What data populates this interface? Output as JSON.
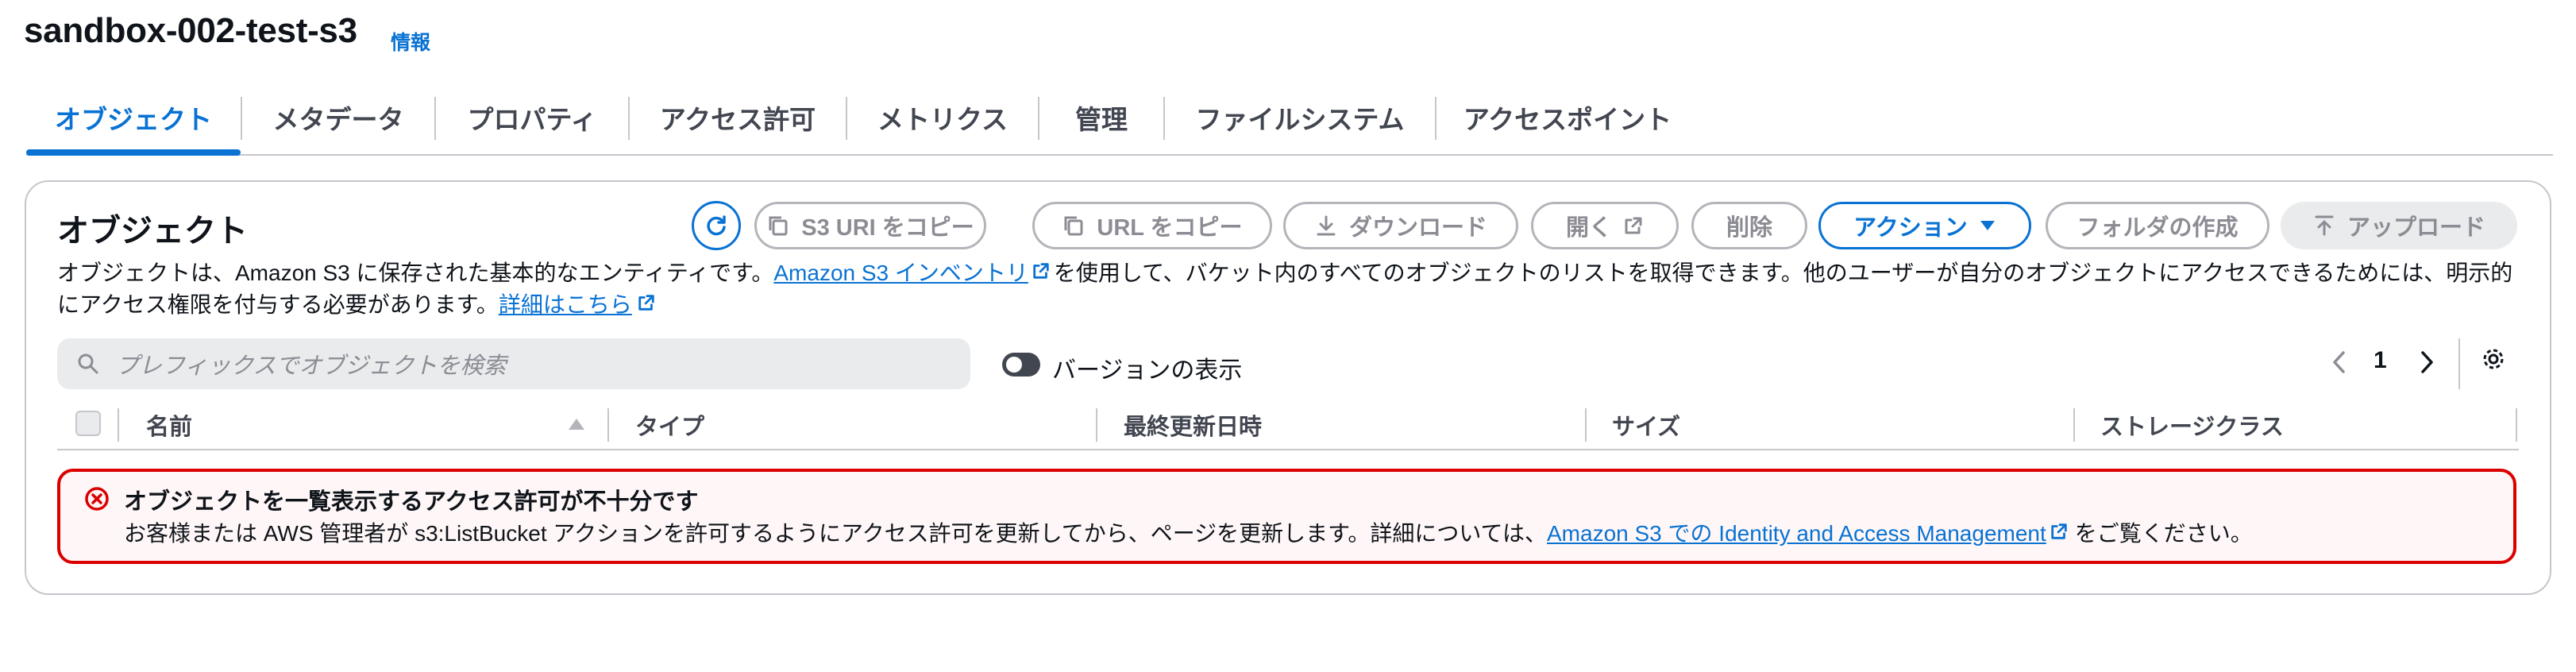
{
  "header": {
    "title": "sandbox-002-test-s3",
    "info_link": "情報"
  },
  "tabs": [
    {
      "label": "オブジェクト"
    },
    {
      "label": "メタデータ"
    },
    {
      "label": "プロパティ"
    },
    {
      "label": "アクセス許可"
    },
    {
      "label": "メトリクス"
    },
    {
      "label": "管理"
    },
    {
      "label": "ファイルシステム"
    },
    {
      "label": "アクセスポイント"
    }
  ],
  "objects": {
    "title": "オブジェクト",
    "buttons": {
      "copy_s3_uri": "S3 URI をコピー",
      "copy_url": "URL をコピー",
      "download": "ダウンロード",
      "open": "開く",
      "delete": "削除",
      "actions": "アクション",
      "create_folder": "フォルダの作成",
      "upload": "アップロード"
    },
    "description": {
      "part1": "オブジェクトは、Amazon S3 に保存された基本的なエンティティです。",
      "link1": "Amazon S3 インベントリ",
      "part2": "を使用して、バケット内のすべてのオブジェクトのリストを取得できます。他のユーザーが自分のオブジェクトにアクセスできるためには、明示的にアクセス権限を付与する必要があります。",
      "link2": "詳細はこちら"
    },
    "search": {
      "placeholder": "プレフィックスでオブジェクトを検索"
    },
    "versions_toggle": {
      "label": "バージョンの表示",
      "on": false
    },
    "pagination": {
      "current_page": "1"
    },
    "table": {
      "columns": [
        "名前",
        "タイプ",
        "最終更新日時",
        "サイズ",
        "ストレージクラス"
      ],
      "sort_column": "名前"
    },
    "alert": {
      "type": "error",
      "title": "オブジェクトを一覧表示するアクセス許可が不十分です",
      "body1": "お客様または AWS 管理者が s3:ListBucket アクションを許可するようにアクセス許可を更新してから、ページを更新します。詳細については、",
      "link": "Amazon S3 での Identity and Access Management",
      "body2": "をご覧ください。"
    }
  },
  "colors": {
    "accent": "#0972d3",
    "error": "#db0000",
    "disabled_text": "#8c8c94",
    "border": "#c6c6cd"
  }
}
